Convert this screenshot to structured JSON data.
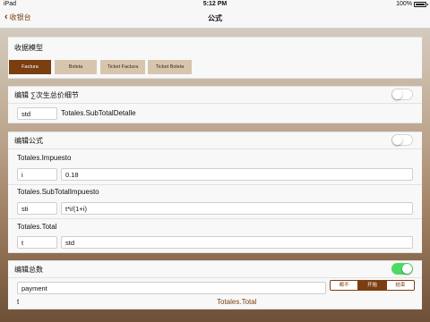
{
  "status_bar": {
    "carrier": "iPad",
    "time": "5:12 PM",
    "battery": "100%"
  },
  "nav": {
    "back_label": "收银台",
    "title": "公式"
  },
  "receipt_model": {
    "title": "收据模型",
    "buttons": [
      {
        "label": "Factura",
        "selected": true
      },
      {
        "label": "Boleta",
        "selected": false
      },
      {
        "label": "Ticket Factura",
        "selected": false
      },
      {
        "label": "Ticket Boleta",
        "selected": false
      }
    ],
    "colors": {
      "selected": "#7a3e10",
      "unselected": "#d8c5ae"
    }
  },
  "edit_subtotal": {
    "title": "编辑 ∑次生总价细节",
    "toggle_on": false,
    "var_value": "std",
    "path_label": "Totales.SubTotalDetalle"
  },
  "edit_formula": {
    "title": "编辑公式",
    "toggle_on": false,
    "rows": [
      {
        "label": "Totales.Impuesto",
        "var": "i",
        "expr": "0.18"
      },
      {
        "label": "Totales.SubTotalImpuesto",
        "var": "sti",
        "expr": "t*i/(1+i)"
      },
      {
        "label": "Totales.Total",
        "var": "t",
        "expr": "std"
      }
    ]
  },
  "edit_total": {
    "title": "编辑总数",
    "toggle_on": true,
    "toggle_color": "#4cd964",
    "payment_value": "payment",
    "segments": [
      {
        "label": "都不",
        "active": false
      },
      {
        "label": "开始",
        "active": true
      },
      {
        "label": "结束",
        "active": false
      }
    ],
    "result_var": "t",
    "result_path": "Totales.Total"
  }
}
